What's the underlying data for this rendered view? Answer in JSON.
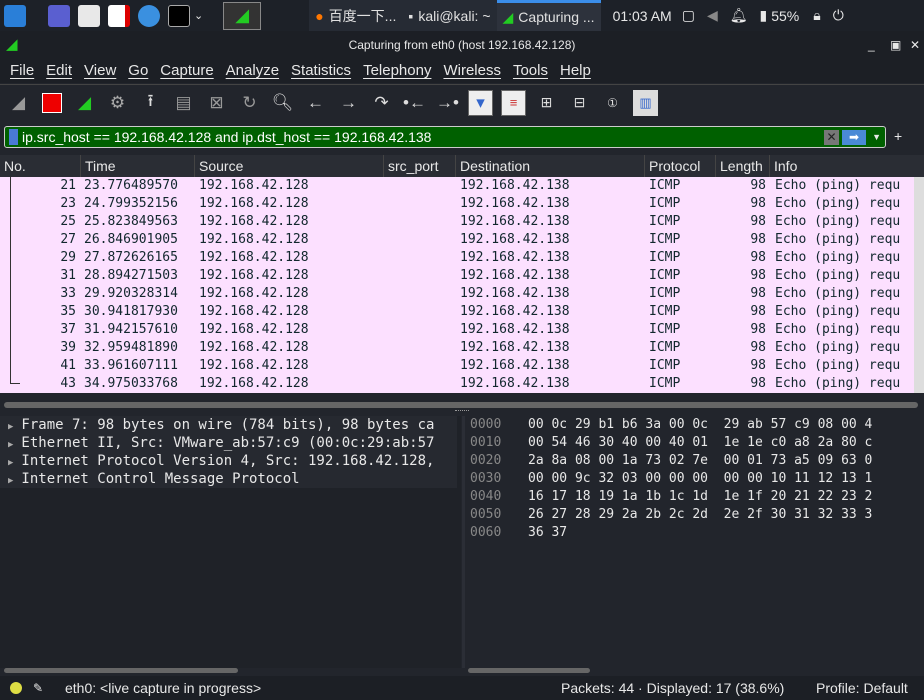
{
  "taskbar": {
    "tasks": [
      "百度一下...",
      "kali@kali: ~",
      "Capturing ..."
    ],
    "clock": "01:03 AM",
    "battery": "55%"
  },
  "window": {
    "title": "Capturing from eth0 (host 192.168.42.128)"
  },
  "menu": [
    "File",
    "Edit",
    "View",
    "Go",
    "Capture",
    "Analyze",
    "Statistics",
    "Telephony",
    "Wireless",
    "Tools",
    "Help"
  ],
  "toolbar": [
    "shark-fin-icon",
    "stop-icon",
    "restart-icon",
    "options-gear-icon",
    "open-upload-icon",
    "file-icon",
    "close-file-icon",
    "reload-icon",
    "search-icon",
    "back-arrow-icon",
    "forward-arrow-icon",
    "goto-icon",
    "first-icon",
    "last-icon",
    "autoscroll-icon",
    "colorize-icon",
    "zoom-in-icon",
    "zoom-out-icon",
    "normal-size-icon",
    "resize-columns-icon"
  ],
  "filter": {
    "value": "ip.src_host == 192.168.42.128 and ip.dst_host == 192.168.42.138",
    "bg_color": "#006000"
  },
  "columns": [
    "No.",
    "Time",
    "Source",
    "src_port",
    "Destination",
    "Protocol",
    "Length",
    "Info"
  ],
  "packets": [
    [
      "21",
      "23.776489570",
      "192.168.42.128",
      "",
      "192.168.42.138",
      "ICMP",
      "98",
      "Echo (ping) requ"
    ],
    [
      "23",
      "24.799352156",
      "192.168.42.128",
      "",
      "192.168.42.138",
      "ICMP",
      "98",
      "Echo (ping) requ"
    ],
    [
      "25",
      "25.823849563",
      "192.168.42.128",
      "",
      "192.168.42.138",
      "ICMP",
      "98",
      "Echo (ping) requ"
    ],
    [
      "27",
      "26.846901905",
      "192.168.42.128",
      "",
      "192.168.42.138",
      "ICMP",
      "98",
      "Echo (ping) requ"
    ],
    [
      "29",
      "27.872626165",
      "192.168.42.128",
      "",
      "192.168.42.138",
      "ICMP",
      "98",
      "Echo (ping) requ"
    ],
    [
      "31",
      "28.894271503",
      "192.168.42.128",
      "",
      "192.168.42.138",
      "ICMP",
      "98",
      "Echo (ping) requ"
    ],
    [
      "33",
      "29.920328314",
      "192.168.42.128",
      "",
      "192.168.42.138",
      "ICMP",
      "98",
      "Echo (ping) requ"
    ],
    [
      "35",
      "30.941817930",
      "192.168.42.128",
      "",
      "192.168.42.138",
      "ICMP",
      "98",
      "Echo (ping) requ"
    ],
    [
      "37",
      "31.942157610",
      "192.168.42.128",
      "",
      "192.168.42.138",
      "ICMP",
      "98",
      "Echo (ping) requ"
    ],
    [
      "39",
      "32.959481890",
      "192.168.42.128",
      "",
      "192.168.42.138",
      "ICMP",
      "98",
      "Echo (ping) requ"
    ],
    [
      "41",
      "33.961607111",
      "192.168.42.128",
      "",
      "192.168.42.138",
      "ICMP",
      "98",
      "Echo (ping) requ"
    ],
    [
      "43",
      "34.975033768",
      "192.168.42.128",
      "",
      "192.168.42.138",
      "ICMP",
      "98",
      "Echo (ping) requ"
    ]
  ],
  "details": [
    "Frame 7: 98 bytes on wire (784 bits), 98 bytes ca",
    "Ethernet II, Src: VMware_ab:57:c9 (00:0c:29:ab:57",
    "Internet Protocol Version 4, Src: 192.168.42.128,",
    "Internet Control Message Protocol"
  ],
  "hex": [
    [
      "0000",
      "00 0c 29 b1 b6 3a 00 0c  29 ab 57 c9 08 00 4"
    ],
    [
      "0010",
      "00 54 46 30 40 00 40 01  1e 1e c0 a8 2a 80 c"
    ],
    [
      "0020",
      "2a 8a 08 00 1a 73 02 7e  00 01 73 a5 09 63 0"
    ],
    [
      "0030",
      "00 00 9c 32 03 00 00 00  00 00 10 11 12 13 1"
    ],
    [
      "0040",
      "16 17 18 19 1a 1b 1c 1d  1e 1f 20 21 22 23 2"
    ],
    [
      "0050",
      "26 27 28 29 2a 2b 2c 2d  2e 2f 30 31 32 33 3"
    ],
    [
      "0060",
      "36 37"
    ]
  ],
  "status": {
    "capture": "eth0: <live capture in progress>",
    "packets": "Packets: 44 · Displayed: 17 (38.6%)",
    "profile": "Profile: Default"
  },
  "colors": {
    "row_bg": "#fce0ff",
    "filter_valid": "#006000"
  }
}
